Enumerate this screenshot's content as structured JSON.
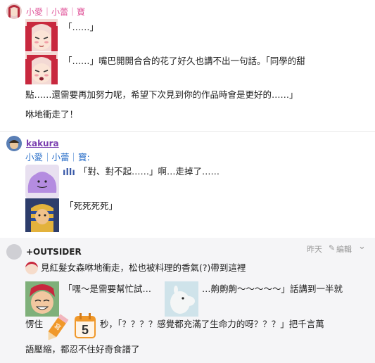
{
  "post1": {
    "author": "小愛｜小蕾｜寶",
    "line1": "「……」",
    "line2": "「……」嘴巴開開合合的花了好久也講不出一句話。「同學的甜",
    "line3": "點……還需要再加努力呢，希望下次見到你的作品時會是更好的……」",
    "line4": "咻地衝走了！"
  },
  "post2": {
    "author": "kakura",
    "mention": "小愛｜小蕾｜寶:",
    "line1": "「對、對不起……」啊…走掉了……",
    "line2": "「死死死死」"
  },
  "post3": {
    "author": "+OUTSIDER",
    "time": "昨天",
    "edit_label": "編輯",
    "line1": "見紅髮女森咻地衝走，松也被料理的香氣(?)帶到這裡",
    "line2a": "「嘿～是需要幫忙試…",
    "line2b": "…齁齁齁～～～～～」話講到一半就",
    "line3a": "愣住",
    "line3b": "秒，「？？？？感覺都充滿了生命力的呀？？？」把千言萬",
    "line4": "語壓縮，都忍不住好奇食譜了",
    "calendar_number": "5"
  },
  "colors": {
    "author_pink": "#e0559a",
    "author_purple": "#7b3fb0",
    "mention_blue": "#2a6fc9",
    "post3_bg": "#f5f5f7"
  }
}
